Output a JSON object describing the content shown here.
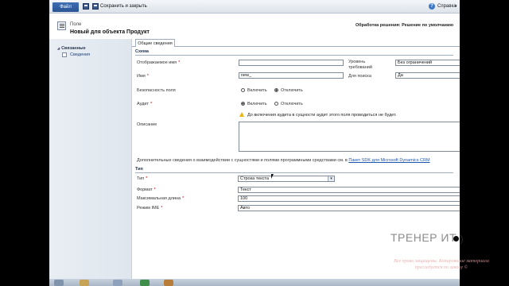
{
  "ribbon": {
    "file_tab": "Файл",
    "save_close_label": "Сохранить и закрыть",
    "help_label": "Справка"
  },
  "header": {
    "entity_type": "Поле",
    "title": "Новый для объекта Продукт",
    "solution": "Обработка решения: Решение по умолчанию"
  },
  "nav": {
    "group": "Связанные",
    "items": [
      "Сведения"
    ]
  },
  "tab": "Общие сведения",
  "schema": {
    "section_title": "Схема",
    "display_name_label": "Отображаемое имя",
    "display_name_value": "",
    "name_label": "Имя",
    "name_value": "new_",
    "requirement_label": "Уровень требований",
    "requirement_value": "Без ограничений",
    "searchable_label": "Для поиска",
    "searchable_value": "Да",
    "field_security_label": "Безопасность поля",
    "field_security_on": "Включить",
    "field_security_off": "Отключить",
    "field_security_selected": "off",
    "audit_label": "Аудит",
    "audit_on": "Включить",
    "audit_off": "Отключить",
    "audit_selected": "on",
    "audit_warning": "До включения аудита в сущности аудит этого поля проводиться не будет.",
    "description_label": "Описание",
    "description_value": "",
    "sdk_text": "Дополнительные сведения о взаимодействии с сущностями и полями программными средствами см. в",
    "sdk_link": "Пакет SDK для Microsoft Dynamics CRM"
  },
  "type_section": {
    "section_title": "Тип",
    "type_label": "Тип",
    "type_value": "Строка текста",
    "format_label": "Формат",
    "format_value": "Текст",
    "max_length_label": "Максимальная длина",
    "max_length_value": "100",
    "ime_label": "Режим IME",
    "ime_value": "Авто"
  },
  "watermark": {
    "brand": "ТРЕНЕР ИТ",
    "note": "Все права защищены. Копирование материала преследуется по закону ©"
  },
  "colors": {
    "file_tab": "#2a5494",
    "required_marker": "#cc0000",
    "link": "#1b57b1",
    "warning": "#f0b400"
  }
}
